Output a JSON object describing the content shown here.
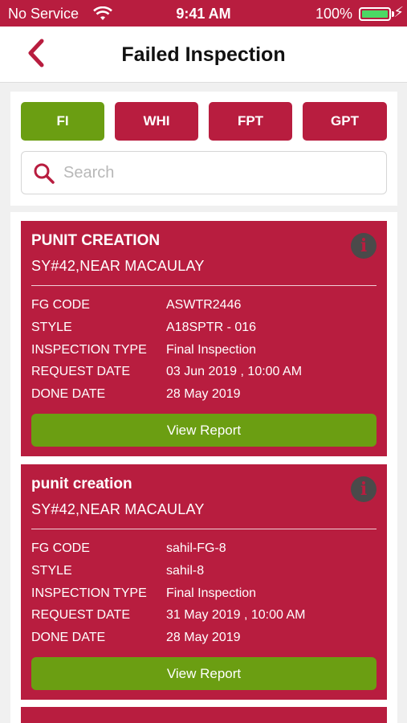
{
  "status_bar": {
    "carrier": "No Service",
    "time": "9:41 AM",
    "battery": "100%"
  },
  "nav": {
    "title": "Failed Inspection"
  },
  "tabs": [
    {
      "label": "FI",
      "active": true
    },
    {
      "label": "WHI",
      "active": false
    },
    {
      "label": "FPT",
      "active": false
    },
    {
      "label": "GPT",
      "active": false
    }
  ],
  "search": {
    "placeholder": "Search"
  },
  "cards": [
    {
      "name": "PUNIT CREATION",
      "address": "SY#42,NEAR MACAULAY",
      "rows": [
        {
          "label": "FG CODE",
          "value": "ASWTR2446"
        },
        {
          "label": "STYLE",
          "value": "A18SPTR - 016"
        },
        {
          "label": "INSPECTION TYPE",
          "value": "Final Inspection"
        },
        {
          "label": "REQUEST DATE",
          "value": "03 Jun 2019 , 10:00 AM"
        },
        {
          "label": "DONE DATE",
          "value": "28 May 2019"
        }
      ],
      "button": "View Report"
    },
    {
      "name": "punit creation",
      "address": "SY#42,NEAR MACAULAY",
      "rows": [
        {
          "label": "FG CODE",
          "value": "sahil-FG-8"
        },
        {
          "label": "STYLE",
          "value": "sahil-8"
        },
        {
          "label": "INSPECTION TYPE",
          "value": "Final Inspection"
        },
        {
          "label": "REQUEST DATE",
          "value": "31 May 2019 , 10:00 AM"
        },
        {
          "label": "DONE DATE",
          "value": "28 May 2019"
        }
      ],
      "button": "View Report"
    }
  ],
  "colors": {
    "brand": "#b81d3f",
    "accent_green": "#6b9e12"
  }
}
